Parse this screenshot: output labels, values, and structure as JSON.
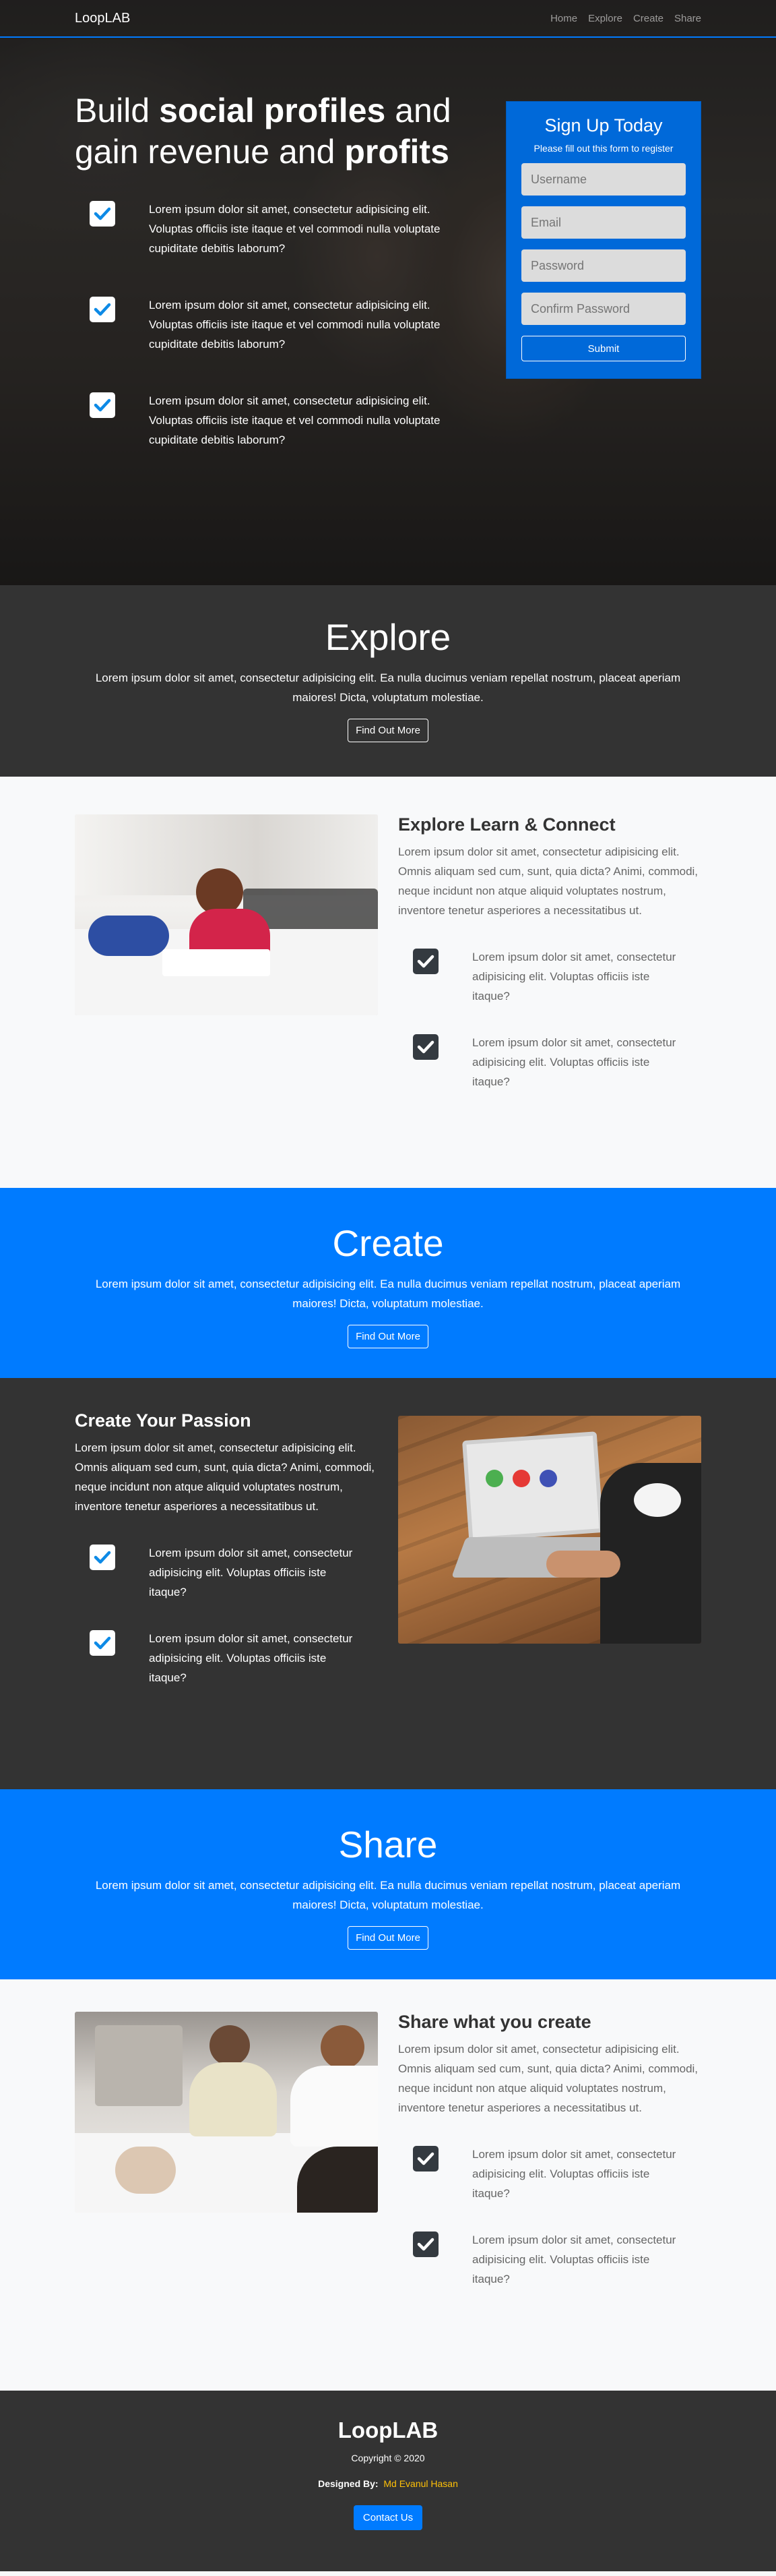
{
  "nav": {
    "brand": "LoopLAB",
    "links": [
      "Home",
      "Explore",
      "Create",
      "Share"
    ]
  },
  "hero": {
    "title_parts": [
      "Build ",
      "social profiles",
      " and gain revenue and ",
      "profits"
    ],
    "items": [
      "Lorem ipsum dolor sit amet, consectetur adipisicing elit. Voluptas officiis iste itaque et vel commodi nulla voluptate cupiditate debitis laborum?",
      "Lorem ipsum dolor sit amet, consectetur adipisicing elit. Voluptas officiis iste itaque et vel commodi nulla voluptate cupiditate debitis laborum?",
      "Lorem ipsum dolor sit amet, consectetur adipisicing elit. Voluptas officiis iste itaque et vel commodi nulla voluptate cupiditate debitis laborum?"
    ]
  },
  "signup": {
    "title": "Sign Up Today",
    "subtitle": "Please fill out this form to register",
    "username": "Username",
    "email": "Email",
    "password": "Password",
    "confirm": "Confirm Password",
    "submit": "Submit"
  },
  "explore_banner": {
    "title": "Explore",
    "text": "Lorem ipsum dolor sit amet, consectetur adipisicing elit. Ea nulla ducimus veniam repellat nostrum, placeat aperiam maiores! Dicta, voluptatum molestiae.",
    "button": "Find Out More"
  },
  "explore_section": {
    "title": "Explore Learn & Connect",
    "text": "Lorem ipsum dolor sit amet, consectetur adipisicing elit. Omnis aliquam sed cum, sunt, quia dicta? Animi, commodi, neque incidunt non atque aliquid voluptates nostrum, inventore tenetur asperiores a necessitatibus ut.",
    "items": [
      "Lorem ipsum dolor sit amet, consectetur adipisicing elit. Voluptas officiis iste itaque?",
      "Lorem ipsum dolor sit amet, consectetur adipisicing elit. Voluptas officiis iste itaque?"
    ]
  },
  "create_banner": {
    "title": "Create",
    "text": "Lorem ipsum dolor sit amet, consectetur adipisicing elit. Ea nulla ducimus veniam repellat nostrum, placeat aperiam maiores! Dicta, voluptatum molestiae.",
    "button": "Find Out More"
  },
  "create_section": {
    "title": "Create Your Passion",
    "text": "Lorem ipsum dolor sit amet, consectetur adipisicing elit. Omnis aliquam sed cum, sunt, quia dicta? Animi, commodi, neque incidunt non atque aliquid voluptates nostrum, inventore tenetur asperiores a necessitatibus ut.",
    "items": [
      "Lorem ipsum dolor sit amet, consectetur adipisicing elit. Voluptas officiis iste itaque?",
      "Lorem ipsum dolor sit amet, consectetur adipisicing elit. Voluptas officiis iste itaque?"
    ]
  },
  "share_banner": {
    "title": "Share",
    "text": "Lorem ipsum dolor sit amet, consectetur adipisicing elit. Ea nulla ducimus veniam repellat nostrum, placeat aperiam maiores! Dicta, voluptatum molestiae.",
    "button": "Find Out More"
  },
  "share_section": {
    "title": "Share what you create",
    "text": "Lorem ipsum dolor sit amet, consectetur adipisicing elit. Omnis aliquam sed cum, sunt, quia dicta? Animi, commodi, neque incidunt non atque aliquid voluptates nostrum, inventore tenetur asperiores a necessitatibus ut.",
    "items": [
      "Lorem ipsum dolor sit amet, consectetur adipisicing elit. Voluptas officiis iste itaque?",
      "Lorem ipsum dolor sit amet, consectetur adipisicing elit. Voluptas officiis iste itaque?"
    ]
  },
  "footer": {
    "brand": "LoopLAB",
    "copyright": "Copyright © 2020",
    "designed_label": "Designed By:",
    "designer": "Md Evanul Hasan",
    "contact": "Contact Us"
  },
  "colors": {
    "primary": "#007bff",
    "dark": "#333333",
    "accent": "#ffc107",
    "check": "#0d8ae6"
  }
}
